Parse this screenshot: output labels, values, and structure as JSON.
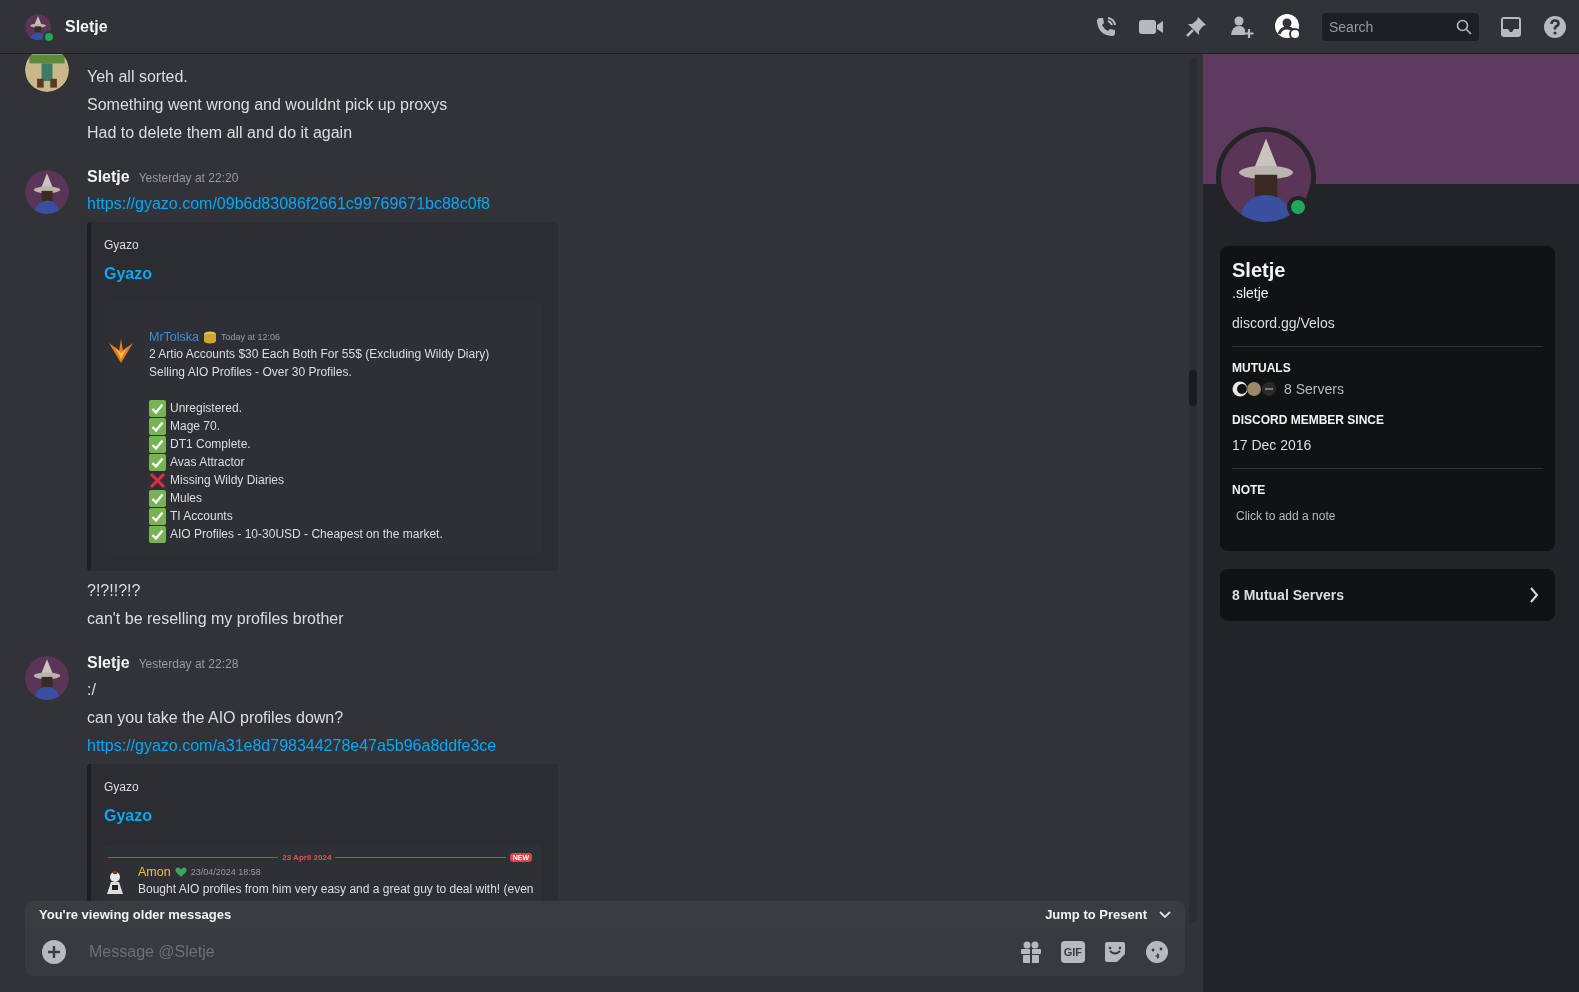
{
  "header": {
    "name": "Sletje",
    "online": true
  },
  "toolbar": {
    "search_placeholder": "Search"
  },
  "messages": [
    {
      "items": [
        {
          "kind": "text",
          "text": "Yeh all sorted."
        },
        {
          "kind": "text",
          "text": "Something went wrong and wouldnt pick up proxys"
        },
        {
          "kind": "text",
          "text": "Had to delete them all and do it again"
        }
      ]
    },
    {
      "author": "Sletje",
      "time": "Yesterday at 22:20",
      "items": [
        {
          "kind": "link",
          "text": "https://gyazo.com/09b6d83086f2661c99769671bc88c0f8"
        },
        {
          "kind": "embed",
          "provider": "Gyazo",
          "title": "Gyazo",
          "shot": {
            "author": "MrTolska",
            "color": "#3f8ed8",
            "time": "Today at 12:06",
            "lines": [
              "2 Artio Accounts $30 Each Both For 55$ (Excluding Wildy Diary)",
              "Selling AIO Profiles - Over 30 Profiles."
            ],
            "checklist": [
              {
                "text": "Unregistered.",
                "checked": true
              },
              {
                "text": "Mage 70.",
                "checked": true
              },
              {
                "text": "DT1 Complete.",
                "checked": true
              },
              {
                "text": "Avas Attractor",
                "checked": true
              },
              {
                "text": "Missing Wildy Diaries",
                "checked": false
              },
              {
                "text": "Mules",
                "checked": true
              },
              {
                "text": "TI Accounts",
                "checked": true
              },
              {
                "text": "AIO Profiles - 10-30USD - Cheapest on the market.",
                "checked": true
              }
            ]
          }
        },
        {
          "kind": "text",
          "text": "?!?!!?!?"
        },
        {
          "kind": "text",
          "text": "can't be reselling my profiles brother"
        }
      ]
    },
    {
      "author": "Sletje",
      "time": "Yesterday at 22:28",
      "items": [
        {
          "kind": "text",
          "text": ":/"
        },
        {
          "kind": "text",
          "text": "can you take the AIO profiles down?"
        },
        {
          "kind": "link",
          "text": "https://gyazo.com/a31e8d798344278e47a5b96a8ddfe3ce"
        },
        {
          "kind": "embed",
          "provider": "Gyazo",
          "title": "Gyazo",
          "shot": {
            "divider": "23 April 2024",
            "badge": "NEW",
            "author": "Amon",
            "color": "#e3c33a",
            "time": "23/04/2024 18:58",
            "lines": [
              "Bought AIO profiles from him very easy and a great guy to deal with! (even"
            ]
          }
        }
      ]
    }
  ],
  "composer": {
    "notice": "You're viewing older messages",
    "jump": "Jump to Present",
    "placeholder": "Message @Sletje",
    "gif_label": "GIF"
  },
  "profile": {
    "name": "Sletje",
    "username": ".sletje",
    "online": true,
    "bio": "discord.gg/Velos",
    "mutuals_heading": "MUTUALS",
    "mutuals": "8 Servers",
    "since_heading": "DISCORD MEMBER SINCE",
    "since": "17 Dec 2016",
    "note_heading": "NOTE",
    "note_placeholder": "Click to add a note",
    "mutual_button": "8 Mutual Servers"
  }
}
